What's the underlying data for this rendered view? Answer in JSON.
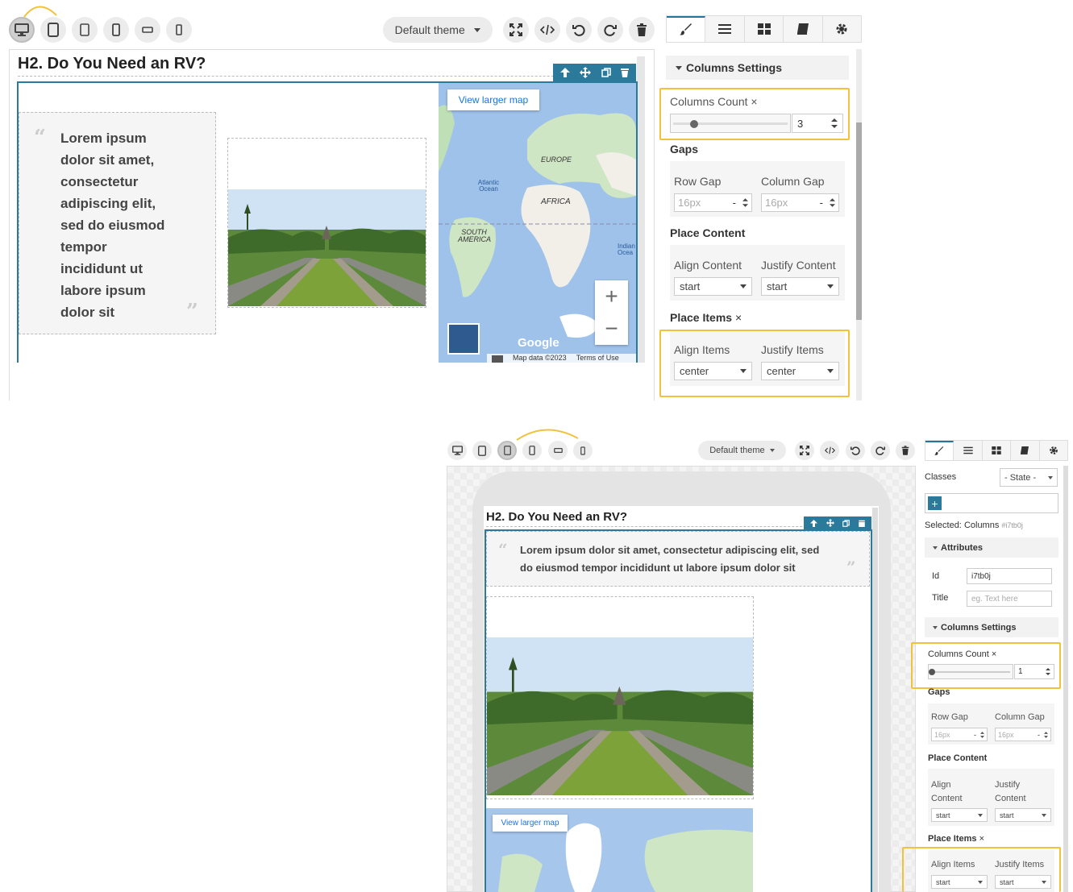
{
  "toolbar_top": {
    "theme_label": "Default theme"
  },
  "toolbar_bottom": {
    "theme_label": "Default theme"
  },
  "canvas_top": {
    "heading": "H2. Do You Need an RV?",
    "quote": "Lorem ipsum dolor sit amet, consectetur adipiscing elit, sed do eiusmod tempor incididunt ut labore ipsum dolor sit",
    "map": {
      "view_larger": "View larger map",
      "labels": {
        "europe": "EUROPE",
        "africa": "AFRICA",
        "south_america": "SOUTH AMERICA",
        "atlantic": "Atlantic Ocean",
        "indian": "Indian Ocea"
      },
      "google": "Google",
      "map_data": "Map data ©2023",
      "terms": "Terms of Use",
      "zoom_in": "+",
      "zoom_out": "−"
    }
  },
  "canvas_bottom": {
    "heading": "H2. Do You Need an RV?",
    "quote": "Lorem ipsum dolor sit amet, consectetur adipiscing elit, sed do eiusmod tempor incididunt ut labore ipsum dolor sit",
    "map": {
      "view_larger": "View larger map"
    }
  },
  "panel_top": {
    "section_title": "Columns Settings",
    "columns_count_label": "Columns Count",
    "columns_count_value": "3",
    "columns_count_slider": 0.2,
    "gaps_label": "Gaps",
    "row_gap_label": "Row Gap",
    "row_gap_value": "16px",
    "column_gap_label": "Column Gap",
    "column_gap_value": "16px",
    "unit_value": "-",
    "place_content_label": "Place Content",
    "align_content_label": "Align Content",
    "align_content_value": "start",
    "justify_content_label": "Justify Content",
    "justify_content_value": "start",
    "place_items_label": "Place Items",
    "align_items_label": "Align Items",
    "align_items_value": "center",
    "justify_items_label": "Justify Items",
    "justify_items_value": "center",
    "clear_icon": "×"
  },
  "panel_bottom": {
    "classes_label": "Classes",
    "state_value": "- State -",
    "add_class": "+",
    "selected_label": "Selected:",
    "selected_name": "Columns",
    "selected_id": "#i7tb0j",
    "attributes_title": "Attributes",
    "id_label": "Id",
    "id_value": "i7tb0j",
    "title_label": "Title",
    "title_placeholder": "eg. Text here",
    "section_title": "Columns Settings",
    "columns_count_label": "Columns Count",
    "columns_count_value": "1",
    "columns_count_slider": 0.0,
    "gaps_label": "Gaps",
    "row_gap_label": "Row Gap",
    "row_gap_value": "16px",
    "column_gap_label": "Column Gap",
    "column_gap_value": "16px",
    "unit_value": "-",
    "place_content_label": "Place Content",
    "align_content_label_1": "Align",
    "align_content_label_2": "Content",
    "align_content_value": "start",
    "justify_content_label_1": "Justify",
    "justify_content_label_2": "Content",
    "justify_content_value": "start",
    "place_items_label": "Place Items",
    "align_items_label": "Align Items",
    "align_items_value": "start",
    "justify_items_label": "Justify Items",
    "justify_items_value": "start",
    "clear_icon": "×"
  },
  "colors": {
    "accent": "#2b7a9b",
    "highlight": "#f2c23d"
  }
}
